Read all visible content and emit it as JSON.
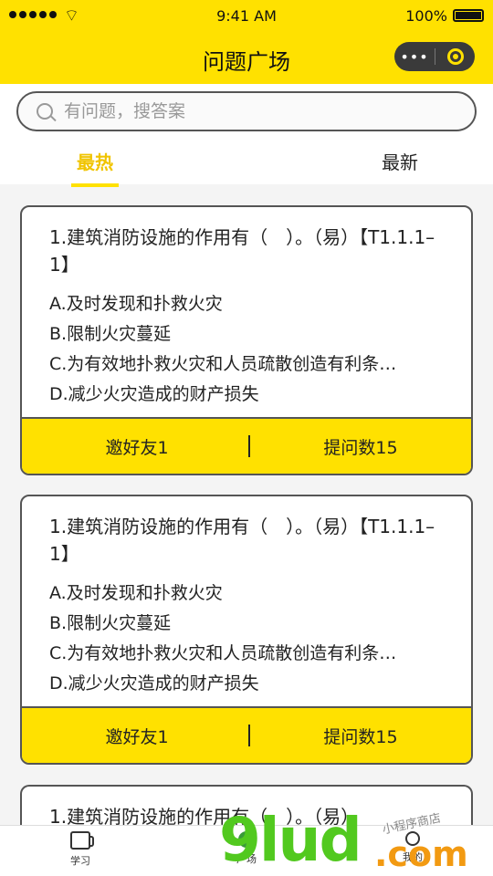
{
  "status_bar": {
    "time": "9:41 AM",
    "battery": "100%"
  },
  "nav": {
    "title": "问题广场",
    "capsule_more": "•••"
  },
  "search": {
    "placeholder": "有问题，搜答案"
  },
  "tabs": [
    {
      "label": "最热",
      "active": true
    },
    {
      "label": "最新",
      "active": false
    }
  ],
  "cards": [
    {
      "title": "1.建筑消防设施的作用有（　）。（易）【T1.1.1–1】",
      "options": [
        "A.及时发现和扑救火灾",
        "B.限制火灾蔓延",
        "C.为有效地扑救火灾和人员疏散创造有利条…",
        "D.减少火灾造成的财产损失"
      ],
      "invite": "邀好友1",
      "count": "提问数15"
    },
    {
      "title": "1.建筑消防设施的作用有（　）。（易）【T1.1.1–1】",
      "options": [
        "A.及时发现和扑救火灾",
        "B.限制火灾蔓延",
        "C.为有效地扑救火灾和人员疏散创造有利条…",
        "D.减少火灾造成的财产损失"
      ],
      "invite": "邀好友1",
      "count": "提问数15"
    },
    {
      "title": "1.建筑消防设施的作用有（　）。（易）"
    }
  ],
  "tab_bar": {
    "items": [
      {
        "label": "学习",
        "icon": "cup-icon"
      },
      {
        "label": "广场",
        "icon": "square-icon"
      },
      {
        "label": "我的",
        "icon": "user-icon"
      }
    ]
  },
  "watermark": {
    "main": "9lud",
    "com": ".com",
    "sub": "小程序商店"
  },
  "colors": {
    "accent": "#ffe100",
    "tab_active": "#f0c400",
    "border": "#555555"
  }
}
